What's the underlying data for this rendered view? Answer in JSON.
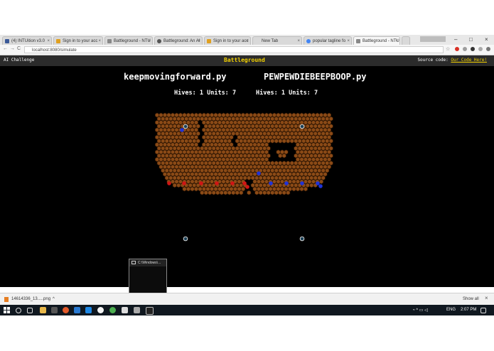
{
  "browser": {
    "tabs": [
      {
        "label": "(4) INTUition v3.0",
        "color": "#3b5998"
      },
      {
        "label": "Sign in to your acc",
        "color": "#e0a020"
      },
      {
        "label": "Battleground - NTU",
        "color": "#888888"
      },
      {
        "label": "Battleground: An AI",
        "color": "#555555"
      },
      {
        "label": "Sign in to your acc",
        "color": "#e0a020"
      },
      {
        "label": "New Tab",
        "color": "#bbbbbb"
      },
      {
        "label": "popular tagline fo",
        "color": "#4285f4"
      },
      {
        "label": "Battleground - NTU",
        "color": "#888888"
      }
    ],
    "tab_close": "×",
    "window_minimize": "–",
    "window_maximize": "□",
    "window_close": "×",
    "nav_back": "←",
    "nav_forward": "→",
    "nav_reload": "C",
    "address": "localhost:8080/simulate",
    "star": "☆"
  },
  "app": {
    "header_left": "AI Challenge",
    "title": "Battleground",
    "source_label": "Source code:",
    "source_link": "Our Code Here!"
  },
  "players": {
    "left": {
      "name": "keepmovingforward.py",
      "hives_label": "Hives:",
      "hives": "1",
      "units_label": "Units:",
      "units": "7"
    },
    "right": {
      "name": "PEWPEWDIEBEEPBOOP.py",
      "hives_label": "Hives:",
      "hives": "1",
      "units_label": "Units:",
      "units": "7"
    }
  },
  "board_colors": {
    "background": "#000000",
    "cell": "#8b4a16",
    "cell_stroke": "#2a1403",
    "red": "#d01515",
    "blue": "#2033d8",
    "hive_fill": "#1a3f55",
    "hive_stroke": "#d8d8d8"
  },
  "cmd": {
    "title": "C:\\Windows\\..."
  },
  "downloads": {
    "file": "14614336_13.....png",
    "caret": "^",
    "show_all": "Show all",
    "close": "×"
  },
  "taskbar": {
    "lang": "ENG",
    "time": "2:07 PM"
  }
}
